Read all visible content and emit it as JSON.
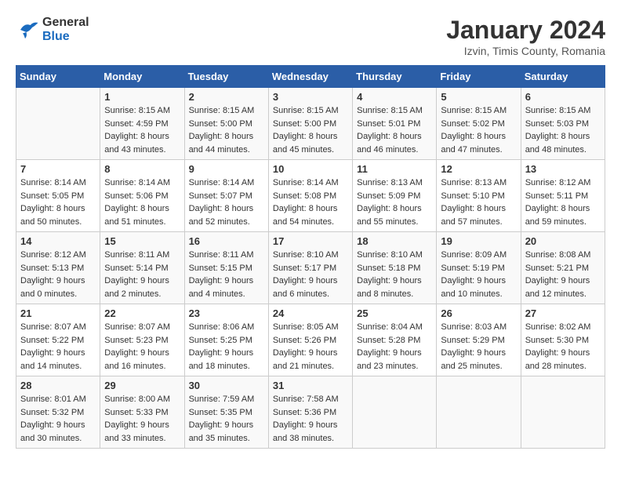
{
  "logo": {
    "line1": "General",
    "line2": "Blue"
  },
  "title": "January 2024",
  "subtitle": "Izvin, Timis County, Romania",
  "weekdays": [
    "Sunday",
    "Monday",
    "Tuesday",
    "Wednesday",
    "Thursday",
    "Friday",
    "Saturday"
  ],
  "weeks": [
    [
      {
        "day": "",
        "sunrise": "",
        "sunset": "",
        "daylight": ""
      },
      {
        "day": "1",
        "sunrise": "Sunrise: 8:15 AM",
        "sunset": "Sunset: 4:59 PM",
        "daylight": "Daylight: 8 hours and 43 minutes."
      },
      {
        "day": "2",
        "sunrise": "Sunrise: 8:15 AM",
        "sunset": "Sunset: 5:00 PM",
        "daylight": "Daylight: 8 hours and 44 minutes."
      },
      {
        "day": "3",
        "sunrise": "Sunrise: 8:15 AM",
        "sunset": "Sunset: 5:00 PM",
        "daylight": "Daylight: 8 hours and 45 minutes."
      },
      {
        "day": "4",
        "sunrise": "Sunrise: 8:15 AM",
        "sunset": "Sunset: 5:01 PM",
        "daylight": "Daylight: 8 hours and 46 minutes."
      },
      {
        "day": "5",
        "sunrise": "Sunrise: 8:15 AM",
        "sunset": "Sunset: 5:02 PM",
        "daylight": "Daylight: 8 hours and 47 minutes."
      },
      {
        "day": "6",
        "sunrise": "Sunrise: 8:15 AM",
        "sunset": "Sunset: 5:03 PM",
        "daylight": "Daylight: 8 hours and 48 minutes."
      }
    ],
    [
      {
        "day": "7",
        "sunrise": "Sunrise: 8:14 AM",
        "sunset": "Sunset: 5:05 PM",
        "daylight": "Daylight: 8 hours and 50 minutes."
      },
      {
        "day": "8",
        "sunrise": "Sunrise: 8:14 AM",
        "sunset": "Sunset: 5:06 PM",
        "daylight": "Daylight: 8 hours and 51 minutes."
      },
      {
        "day": "9",
        "sunrise": "Sunrise: 8:14 AM",
        "sunset": "Sunset: 5:07 PM",
        "daylight": "Daylight: 8 hours and 52 minutes."
      },
      {
        "day": "10",
        "sunrise": "Sunrise: 8:14 AM",
        "sunset": "Sunset: 5:08 PM",
        "daylight": "Daylight: 8 hours and 54 minutes."
      },
      {
        "day": "11",
        "sunrise": "Sunrise: 8:13 AM",
        "sunset": "Sunset: 5:09 PM",
        "daylight": "Daylight: 8 hours and 55 minutes."
      },
      {
        "day": "12",
        "sunrise": "Sunrise: 8:13 AM",
        "sunset": "Sunset: 5:10 PM",
        "daylight": "Daylight: 8 hours and 57 minutes."
      },
      {
        "day": "13",
        "sunrise": "Sunrise: 8:12 AM",
        "sunset": "Sunset: 5:11 PM",
        "daylight": "Daylight: 8 hours and 59 minutes."
      }
    ],
    [
      {
        "day": "14",
        "sunrise": "Sunrise: 8:12 AM",
        "sunset": "Sunset: 5:13 PM",
        "daylight": "Daylight: 9 hours and 0 minutes."
      },
      {
        "day": "15",
        "sunrise": "Sunrise: 8:11 AM",
        "sunset": "Sunset: 5:14 PM",
        "daylight": "Daylight: 9 hours and 2 minutes."
      },
      {
        "day": "16",
        "sunrise": "Sunrise: 8:11 AM",
        "sunset": "Sunset: 5:15 PM",
        "daylight": "Daylight: 9 hours and 4 minutes."
      },
      {
        "day": "17",
        "sunrise": "Sunrise: 8:10 AM",
        "sunset": "Sunset: 5:17 PM",
        "daylight": "Daylight: 9 hours and 6 minutes."
      },
      {
        "day": "18",
        "sunrise": "Sunrise: 8:10 AM",
        "sunset": "Sunset: 5:18 PM",
        "daylight": "Daylight: 9 hours and 8 minutes."
      },
      {
        "day": "19",
        "sunrise": "Sunrise: 8:09 AM",
        "sunset": "Sunset: 5:19 PM",
        "daylight": "Daylight: 9 hours and 10 minutes."
      },
      {
        "day": "20",
        "sunrise": "Sunrise: 8:08 AM",
        "sunset": "Sunset: 5:21 PM",
        "daylight": "Daylight: 9 hours and 12 minutes."
      }
    ],
    [
      {
        "day": "21",
        "sunrise": "Sunrise: 8:07 AM",
        "sunset": "Sunset: 5:22 PM",
        "daylight": "Daylight: 9 hours and 14 minutes."
      },
      {
        "day": "22",
        "sunrise": "Sunrise: 8:07 AM",
        "sunset": "Sunset: 5:23 PM",
        "daylight": "Daylight: 9 hours and 16 minutes."
      },
      {
        "day": "23",
        "sunrise": "Sunrise: 8:06 AM",
        "sunset": "Sunset: 5:25 PM",
        "daylight": "Daylight: 9 hours and 18 minutes."
      },
      {
        "day": "24",
        "sunrise": "Sunrise: 8:05 AM",
        "sunset": "Sunset: 5:26 PM",
        "daylight": "Daylight: 9 hours and 21 minutes."
      },
      {
        "day": "25",
        "sunrise": "Sunrise: 8:04 AM",
        "sunset": "Sunset: 5:28 PM",
        "daylight": "Daylight: 9 hours and 23 minutes."
      },
      {
        "day": "26",
        "sunrise": "Sunrise: 8:03 AM",
        "sunset": "Sunset: 5:29 PM",
        "daylight": "Daylight: 9 hours and 25 minutes."
      },
      {
        "day": "27",
        "sunrise": "Sunrise: 8:02 AM",
        "sunset": "Sunset: 5:30 PM",
        "daylight": "Daylight: 9 hours and 28 minutes."
      }
    ],
    [
      {
        "day": "28",
        "sunrise": "Sunrise: 8:01 AM",
        "sunset": "Sunset: 5:32 PM",
        "daylight": "Daylight: 9 hours and 30 minutes."
      },
      {
        "day": "29",
        "sunrise": "Sunrise: 8:00 AM",
        "sunset": "Sunset: 5:33 PM",
        "daylight": "Daylight: 9 hours and 33 minutes."
      },
      {
        "day": "30",
        "sunrise": "Sunrise: 7:59 AM",
        "sunset": "Sunset: 5:35 PM",
        "daylight": "Daylight: 9 hours and 35 minutes."
      },
      {
        "day": "31",
        "sunrise": "Sunrise: 7:58 AM",
        "sunset": "Sunset: 5:36 PM",
        "daylight": "Daylight: 9 hours and 38 minutes."
      },
      {
        "day": "",
        "sunrise": "",
        "sunset": "",
        "daylight": ""
      },
      {
        "day": "",
        "sunrise": "",
        "sunset": "",
        "daylight": ""
      },
      {
        "day": "",
        "sunrise": "",
        "sunset": "",
        "daylight": ""
      }
    ]
  ]
}
